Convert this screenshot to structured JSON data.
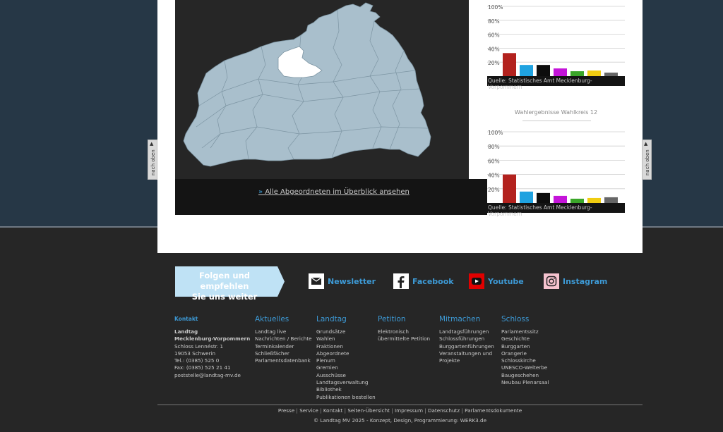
{
  "map_link": {
    "arrow": "»",
    "text": "Alle Abgeordneten im Überblick ansehen"
  },
  "side_tab": {
    "arrow": "▲",
    "label": "nach oben"
  },
  "charts": [
    {
      "title": "",
      "source": "Quelle: Statistisches Amt Mecklenburg-Vorpommern"
    },
    {
      "title": "Wahlergebnisse Wahlkreis 12",
      "source": "Quelle: Statistisches Amt Mecklenburg-Vorpommern"
    }
  ],
  "chart_data": [
    {
      "type": "bar",
      "ytick_labels": [
        "100%",
        "80%",
        "60%",
        "40%",
        "20%"
      ],
      "ylim": [
        0,
        100
      ],
      "values": [
        33,
        16,
        16,
        11,
        7,
        8,
        5
      ],
      "colors": [
        "#b3221e",
        "#1fa2e0",
        "#0d0d0d",
        "#c414d9",
        "#3aa629",
        "#f0cc10",
        "#666666"
      ]
    },
    {
      "type": "bar",
      "ytick_labels": [
        "100%",
        "80%",
        "60%",
        "40%",
        "20%"
      ],
      "ylim": [
        0,
        100
      ],
      "values": [
        40,
        16,
        14,
        10,
        6,
        7,
        8
      ],
      "colors": [
        "#b3221e",
        "#1fa2e0",
        "#0d0d0d",
        "#c414d9",
        "#3aa629",
        "#f0cc10",
        "#666666"
      ]
    }
  ],
  "follow": {
    "line1": "Folgen und empfehlen",
    "line2": "Sie uns weiter"
  },
  "social": [
    {
      "label": "Newsletter",
      "icon": "newsletter-icon"
    },
    {
      "label": "Facebook",
      "icon": "facebook-icon"
    },
    {
      "label": "Youtube",
      "icon": "youtube-icon"
    },
    {
      "label": "Instagram",
      "icon": "instagram-icon"
    }
  ],
  "kontakt": {
    "heading": "Kontakt",
    "name1": "Landtag",
    "name2": "Mecklenburg-Vorpommern",
    "street": "Schloss Lennéstr. 1",
    "city": "19053 Schwerin",
    "tel": "Tel.: (0385) 525 0",
    "fax": "Fax: (0385) 525 21 41",
    "email": "poststelle@landtag-mv.de"
  },
  "columns": [
    {
      "heading": "Aktuelles",
      "items": [
        "Landtag live",
        "Nachrichten / Berichte",
        "Terminkalender",
        "Schließfächer",
        "Parlamentsdatenbank"
      ]
    },
    {
      "heading": "Landtag",
      "items": [
        "Grundsätze",
        "Wahlen",
        "Fraktionen",
        "Abgeordnete",
        "Plenum",
        "Gremien",
        "Ausschüsse",
        "Landtagsverwaltung",
        "Bibliothek",
        "Publikationen bestellen"
      ]
    },
    {
      "heading": "Petition",
      "items": [
        "Elektronisch",
        "übermittelte Petition"
      ]
    },
    {
      "heading": "Mitmachen",
      "items": [
        "Landtagsführungen",
        "Schlossführungen",
        "Burggartenführungen",
        "Veranstaltungen und",
        "Projekte"
      ]
    },
    {
      "heading": "Schloss",
      "items": [
        "Parlamentssitz",
        "Geschichte",
        "Burggarten",
        "Orangerie",
        "Schlosskirche",
        "UNESCO-Welterbe",
        "Baugeschehen",
        "Neubau Plenarsaal"
      ]
    }
  ],
  "bottom_links": [
    "Presse",
    "Service",
    "Kontakt",
    "Seiten-Übersicht",
    "Impressum",
    "Datenschutz",
    "Parlamentsdokumente"
  ],
  "copyright": "© Landtag MV 2025 - Konzept, Design, Programmierung: WERK3.de"
}
